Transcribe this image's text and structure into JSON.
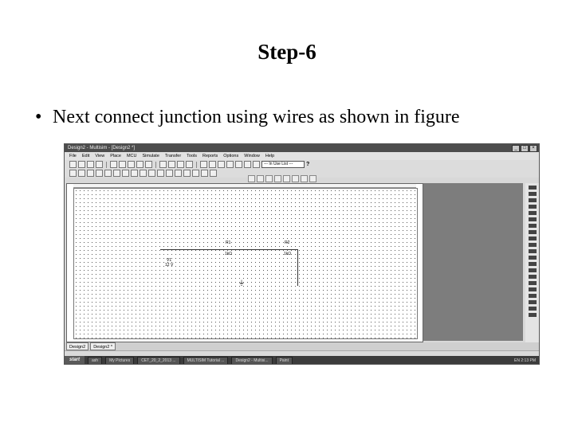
{
  "slide": {
    "title": "Step-6",
    "bullet": "Next connect junction using wires as shown in figure"
  },
  "app": {
    "window_title": "Design2 - Multisim - [Design2 *]",
    "menus": [
      "File",
      "Edit",
      "View",
      "Place",
      "MCU",
      "Simulate",
      "Transfer",
      "Tools",
      "Reports",
      "Options",
      "Window",
      "Help"
    ],
    "component_combo": "--- In Use List ---",
    "help_icon": "?",
    "circuit": {
      "r1_name": "R1",
      "r1_value": "1kΩ",
      "r2_name": "R2",
      "r2_value": "1kΩ",
      "v1_name": "V1",
      "v1_value": "12 V"
    },
    "tabs": [
      "Design2",
      "Design2 *"
    ],
    "taskbar": {
      "start": "start",
      "items": [
        "ash",
        "My Pictures",
        "CET_20_2_2013 ...",
        "MULTISIM Tutorial ...",
        "Design2 - Multisi...",
        "Paint"
      ],
      "tray": "EN  2:13 PM"
    }
  }
}
